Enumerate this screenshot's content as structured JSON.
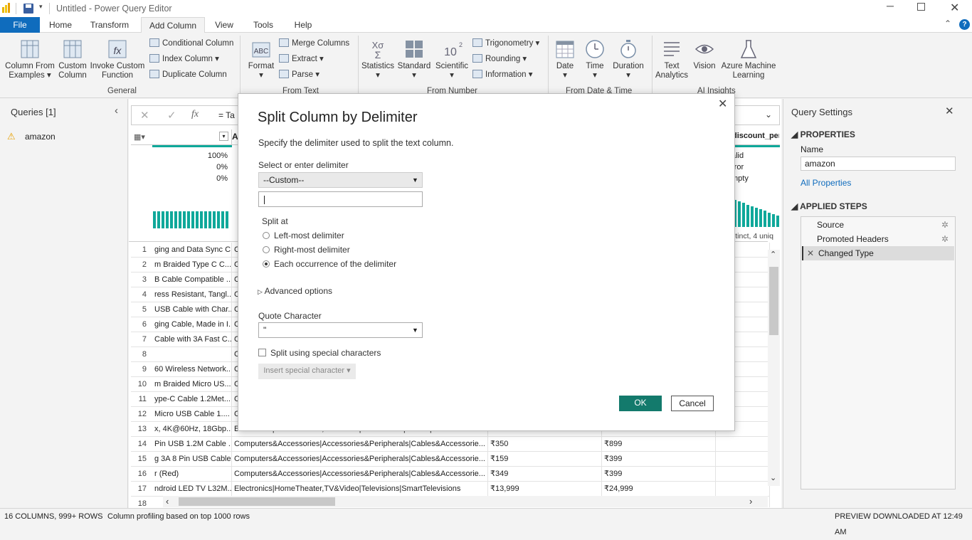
{
  "window": {
    "title": "Untitled - Power Query Editor"
  },
  "tabs": [
    "File",
    "Home",
    "Transform",
    "Add Column",
    "View",
    "Tools",
    "Help"
  ],
  "ribbon": {
    "general": {
      "label": "General",
      "column_from_examples": [
        "Column From",
        "Examples"
      ],
      "custom_column": [
        "Custom",
        "Column"
      ],
      "invoke_custom_function": [
        "Invoke Custom",
        "Function"
      ],
      "conditional_column": "Conditional Column",
      "index_column": "Index Column",
      "duplicate_column": "Duplicate Column"
    },
    "from_text": {
      "label": "From Text",
      "format": "Format",
      "merge_columns": "Merge Columns",
      "extract": "Extract",
      "parse": "Parse"
    },
    "from_number": {
      "label": "From Number",
      "statistics": "Statistics",
      "standard": "Standard",
      "scientific": "Scientific",
      "trigonometry": "Trigonometry",
      "rounding": "Rounding",
      "information": "Information"
    },
    "from_datetime": {
      "label": "From Date & Time",
      "date": "Date",
      "time": "Time",
      "duration": "Duration"
    },
    "ai": {
      "label": "AI Insights",
      "text_analytics": [
        "Text",
        "Analytics"
      ],
      "vision": "Vision",
      "azure_ml": [
        "Azure Machine",
        "Learning"
      ]
    }
  },
  "queries": {
    "title": "Queries [1]",
    "items": [
      {
        "name": "amazon"
      }
    ]
  },
  "formula": {
    "prefix": "= Ta"
  },
  "columns": {
    "col1_name": "",
    "col2_name": "A",
    "col_last_name": "discount_perc"
  },
  "profile": {
    "col1": {
      "valid": "100%",
      "error": "0%",
      "empty": "0%"
    },
    "col_last": {
      "valid": "alid",
      "error": "rror",
      "empty": "mpty",
      "distinct": "stinct, 4 uniq"
    }
  },
  "rows": [
    {
      "n": "1",
      "c1": "ging and Data Sync C...",
      "c2": "C",
      "c3": "",
      "c4": ""
    },
    {
      "n": "2",
      "c1": "m Braided Type C C...",
      "c2": "C",
      "c3": "",
      "c4": ""
    },
    {
      "n": "3",
      "c1": "B Cable Compatible ...",
      "c2": "C",
      "c3": "",
      "c4": ""
    },
    {
      "n": "4",
      "c1": "ress Resistant, Tangl...",
      "c2": "C",
      "c3": "",
      "c4": ""
    },
    {
      "n": "5",
      "c1": "USB Cable with Char...",
      "c2": "C",
      "c3": "",
      "c4": ""
    },
    {
      "n": "6",
      "c1": "ging Cable, Made in I...",
      "c2": "C",
      "c3": "",
      "c4": ""
    },
    {
      "n": "7",
      "c1": "Cable with 3A Fast C...",
      "c2": "C",
      "c3": "",
      "c4": ""
    },
    {
      "n": "8",
      "c1": "",
      "c2": "C",
      "c3": "",
      "c4": ""
    },
    {
      "n": "9",
      "c1": "60 Wireless Network...",
      "c2": "C",
      "c3": "",
      "c4": ""
    },
    {
      "n": "10",
      "c1": "m Braided Micro US...",
      "c2": "C",
      "c3": "",
      "c4": ""
    },
    {
      "n": "11",
      "c1": "ype-C Cable 1.2Met...",
      "c2": "C",
      "c3": "",
      "c4": ""
    },
    {
      "n": "12",
      "c1": "Micro USB Cable 1....",
      "c2": "C",
      "c3": "",
      "c4": ""
    },
    {
      "n": "13",
      "c1": "x, 4K@60Hz, 18Gbp...",
      "c2": "Electronics|HomeTheater,TV&Video|Accessories|Cables|HDMICables",
      "c3": "₹219",
      "c4": "₹700"
    },
    {
      "n": "14",
      "c1": "Pin USB 1.2M Cable ...",
      "c2": "Computers&Accessories|Accessories&Peripherals|Cables&Accessorie...",
      "c3": "₹350",
      "c4": "₹899"
    },
    {
      "n": "15",
      "c1": "g 3A 8 Pin USB Cable...",
      "c2": "Computers&Accessories|Accessories&Peripherals|Cables&Accessorie...",
      "c3": "₹159",
      "c4": "₹399"
    },
    {
      "n": "16",
      "c1": "r (Red)",
      "c2": "Computers&Accessories|Accessories&Peripherals|Cables&Accessorie...",
      "c3": "₹349",
      "c4": "₹399"
    },
    {
      "n": "17",
      "c1": "ndroid LED TV L32M...",
      "c2": "Electronics|HomeTheater,TV&Video|Televisions|SmartTelevisions",
      "c3": "₹13,999",
      "c4": "₹24,999"
    },
    {
      "n": "18",
      "c1": "",
      "c2": "",
      "c3": "",
      "c4": ""
    }
  ],
  "dialog": {
    "title": "Split Column by Delimiter",
    "subtitle": "Specify the delimiter used to split the text column.",
    "delimiter_label": "Select or enter delimiter",
    "delimiter_value": "--Custom--",
    "custom_value": "",
    "split_at_label": "Split at",
    "split_options": [
      "Left-most delimiter",
      "Right-most delimiter",
      "Each occurrence of the delimiter"
    ],
    "split_selected_index": 2,
    "advanced": "Advanced options",
    "quote_label": "Quote Character",
    "quote_value": "\"",
    "special_chars_label": "Split using special characters",
    "special_chars_checked": false,
    "insert_special": "Insert special character",
    "ok": "OK",
    "cancel": "Cancel"
  },
  "settings": {
    "title": "Query Settings",
    "properties": "PROPERTIES",
    "name_label": "Name",
    "name_value": "amazon",
    "all_properties": "All Properties",
    "applied_steps": "APPLIED STEPS",
    "steps": [
      "Source",
      "Promoted Headers",
      "Changed Type"
    ]
  },
  "status": {
    "columns": "16 COLUMNS, 999+ ROWS",
    "profiling": "Column profiling based on top 1000 rows",
    "preview": "PREVIEW DOWNLOADED AT 12:49 AM"
  },
  "colors": {
    "accent": "#0f6cbd",
    "ok": "#137a6c",
    "teal": "#0fa89a"
  }
}
